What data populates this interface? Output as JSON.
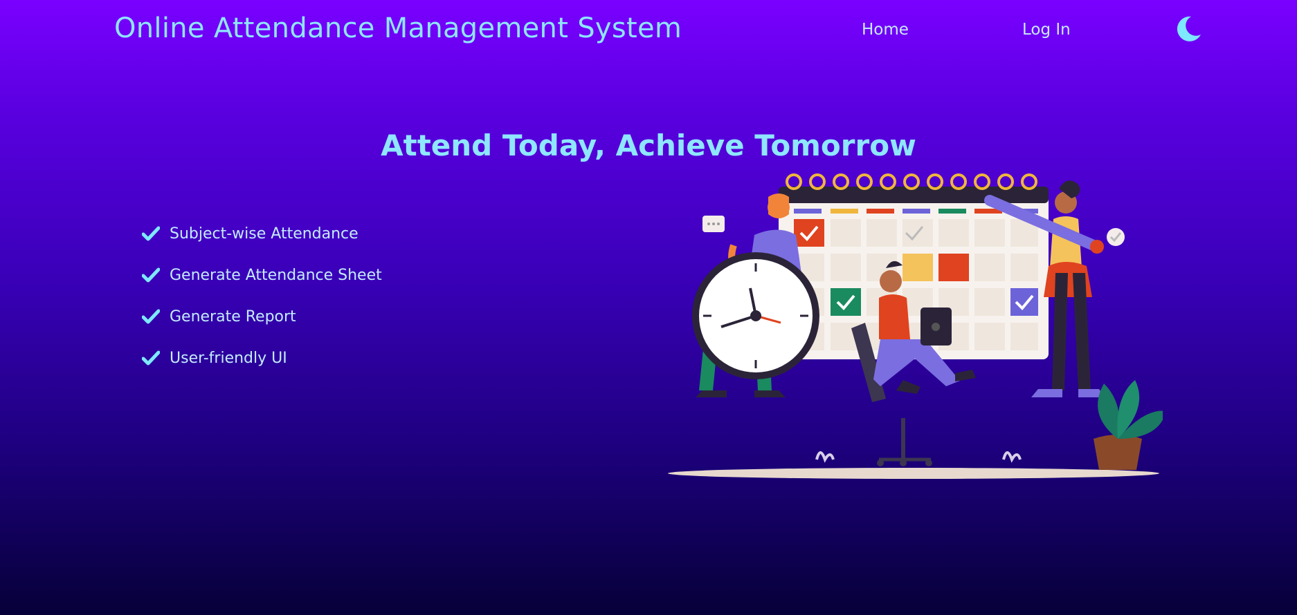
{
  "navbar": {
    "brand": "Online Attendance Management System",
    "links": [
      {
        "label": "Home"
      },
      {
        "label": "Log In"
      }
    ],
    "theme_toggle_icon": "moon-icon"
  },
  "hero": {
    "tagline": "Attend Today, Achieve Tomorrow",
    "features": [
      "Subject-wise Attendance",
      "Generate Attendance Sheet",
      "Generate Report",
      "User-friendly UI"
    ],
    "feature_icon": "check-icon",
    "illustration_icon": "attendance-illustration"
  },
  "colors": {
    "bg_top": "#7a00ff",
    "bg_bottom": "#060038",
    "accent": "#8ee6ff"
  }
}
